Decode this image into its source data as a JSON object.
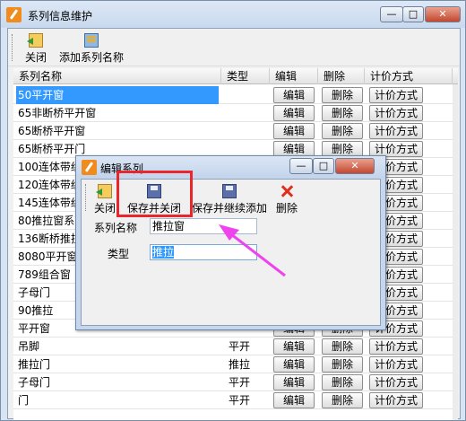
{
  "main_window": {
    "title": "系列信息维护",
    "controls": {
      "minimize": "—",
      "maximize": "□",
      "close": "✕"
    }
  },
  "toolbar": {
    "close_label": "关闭",
    "add_label": "添加系列名称"
  },
  "grid": {
    "headers": [
      "系列名称",
      "类型",
      "编辑",
      "删除",
      "计价方式"
    ],
    "edit_label": "编辑",
    "delete_label": "删除",
    "price_label": "计价方式",
    "rows": [
      {
        "name": "50平开窗",
        "type": "",
        "buttons": true
      },
      {
        "name": "65非断桥平开窗",
        "type": "",
        "buttons": true
      },
      {
        "name": "65断桥平开窗",
        "type": "",
        "buttons": true
      },
      {
        "name": "65断桥平开门",
        "type": "",
        "buttons": true
      },
      {
        "name": "100连体带纱",
        "type": "",
        "buttons": true
      },
      {
        "name": "120连体带纱",
        "type": "",
        "buttons": true
      },
      {
        "name": "145连体带纱",
        "type": "",
        "buttons": true
      },
      {
        "name": "80推拉窗系列",
        "type": "",
        "buttons": true
      },
      {
        "name": "136断桥推拉",
        "type": "",
        "buttons": true
      },
      {
        "name": "8080平开窗",
        "type": "",
        "buttons": true
      },
      {
        "name": "789组合窗",
        "type": "",
        "buttons": true
      },
      {
        "name": "子母门",
        "type": "",
        "buttons": true
      },
      {
        "name": "90推拉",
        "type": "",
        "buttons": true
      },
      {
        "name": "平开窗",
        "type": "",
        "buttons": true
      },
      {
        "name": "吊脚",
        "type": "平开",
        "buttons": true
      },
      {
        "name": "推拉门",
        "type": "推拉",
        "buttons": true
      },
      {
        "name": "子母门",
        "type": "平开",
        "buttons": true
      },
      {
        "name": "门",
        "type": "平开",
        "buttons": true
      }
    ],
    "selected_index": 0
  },
  "dialog": {
    "title": "编辑系列",
    "controls": {
      "minimize": "—",
      "maximize": "□",
      "close": "✕"
    },
    "toolbar": {
      "close_label": "关闭",
      "save_close_label": "保存并关闭",
      "save_continue_label": "保存并继续添加",
      "delete_label": "删除"
    },
    "form": {
      "name_label": "系列名称",
      "name_value": "推拉窗",
      "type_label": "类型",
      "type_value": "推拉"
    }
  },
  "annotation": {
    "box_color": "#e8262b",
    "arrow_color": "#ee44ee"
  }
}
